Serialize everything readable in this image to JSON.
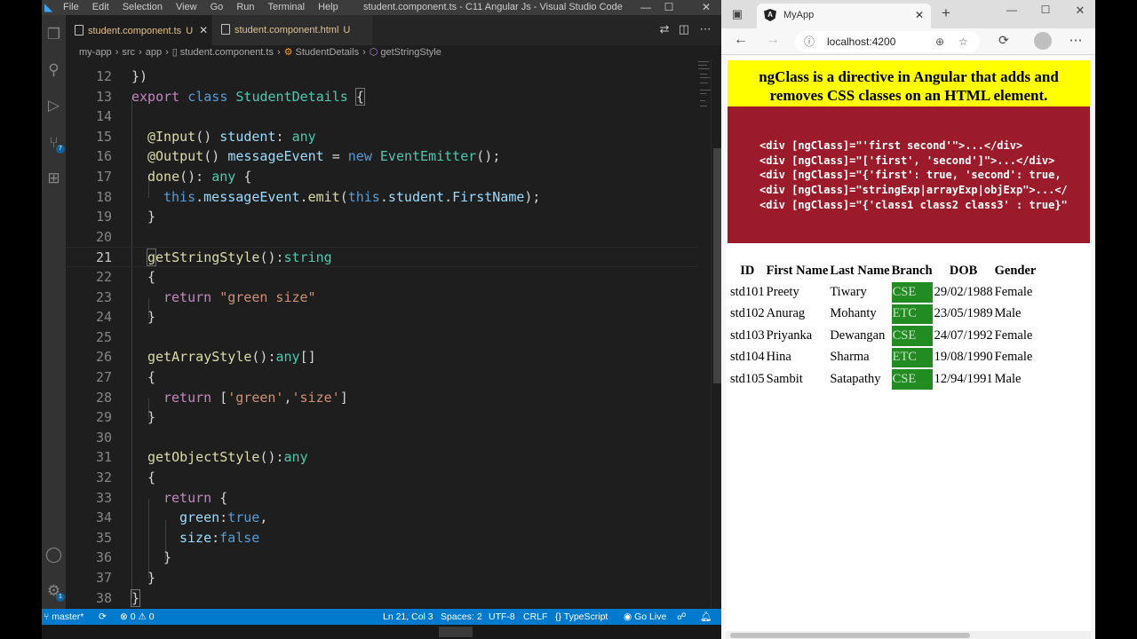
{
  "vscode": {
    "menu": [
      "File",
      "Edit",
      "Selection",
      "View",
      "Go",
      "Run",
      "Terminal",
      "Help"
    ],
    "window_title": "student.component.ts - C11 Angular Js - Visual Studio Code",
    "tabs": [
      {
        "label": "student.component.ts",
        "status": "U",
        "active": true
      },
      {
        "label": "student.component.html",
        "status": "U",
        "active": false
      }
    ],
    "breadcrumb": [
      "my-app",
      "src",
      "app",
      "student.component.ts",
      "StudentDetails",
      "getStringStyle"
    ],
    "line_numbers": [
      "12",
      "13",
      "14",
      "15",
      "16",
      "17",
      "18",
      "19",
      "20",
      "21",
      "22",
      "23",
      "24",
      "25",
      "26",
      "27",
      "28",
      "29",
      "30",
      "31",
      "32",
      "33",
      "34",
      "35",
      "36",
      "37",
      "38"
    ],
    "current_line": "21",
    "code": {
      "l12": "})",
      "l13": {
        "kw": "export",
        "kw2": "class",
        "name": "StudentDetails",
        "brace": "{"
      },
      "l15": {
        "dec": "@Input",
        "paren": "()",
        "prop": "student",
        "colon": ":",
        "type": "any"
      },
      "l16": {
        "dec": "@Output",
        "paren": "()",
        "prop": "messageEvent",
        "eq": " = ",
        "kw": "new",
        "cls": "EventEmitter",
        "tail": "();"
      },
      "l17": {
        "fn": "done",
        "paren": "(): ",
        "type": "any",
        "brace": " {"
      },
      "l18": {
        "this1": "this",
        "dot1": ".",
        "prop1": "messageEvent",
        "dot2": ".",
        "fn": "emit",
        "p1": "(",
        "this2": "this",
        "dot3": ".",
        "prop2": "student",
        "dot4": ".",
        "prop3": "FirstName",
        "tail": ");"
      },
      "l19": "}",
      "l21": {
        "fn_first": "g",
        "fn_rest": "etStringStyle",
        "paren": "():",
        "type": "string"
      },
      "l22": "{",
      "l23": {
        "kw": "return",
        "str": "\"green size\""
      },
      "l24": "}",
      "l26": {
        "fn": "getArrayStyle",
        "paren": "():",
        "type": "any",
        "arr": "[]"
      },
      "l27": "{",
      "l28": {
        "kw": "return",
        "open": "[",
        "s1": "'green'",
        "comma": ",",
        "s2": "'size'",
        "close": "]"
      },
      "l29": "}",
      "l31": {
        "fn": "getObjectStyle",
        "paren": "():",
        "type": "any"
      },
      "l32": "{",
      "l33": {
        "kw": "return",
        "brace": " {"
      },
      "l34": {
        "key": "green",
        "colon": ":",
        "val": "true",
        "comma": ","
      },
      "l35": {
        "key": "size",
        "colon": ":",
        "val": "false"
      },
      "l36": "}",
      "l37": "}",
      "l38": "}"
    },
    "status": {
      "branch": "master*",
      "problems": "⊗ 0 ⚠ 0",
      "position": "Ln 21, Col 3",
      "spaces": "Spaces: 2",
      "encoding": "UTF-8",
      "eol": "CRLF",
      "language": "TypeScript",
      "golive": "Go Live"
    },
    "source_control_badge": "7",
    "accounts_badge": "1"
  },
  "browser": {
    "tab_title": "MyApp",
    "url": "localhost:4200",
    "heading_line1": "ngClass is a directive in Angular that adds and",
    "heading_line2": "removes CSS classes on an HTML element.",
    "code_lines": [
      "<div [ngClass]=\"'first second'\">...</div>",
      "<div [ngClass]=\"['first', 'second']\">...</div>",
      "<div [ngClass]=\"{'first': true, 'second': true,",
      "<div [ngClass]=\"stringExp|arrayExp|objExp\">...</",
      "<div [ngClass]=\"{'class1 class2 class3' : true}\""
    ],
    "table": {
      "headers": [
        "ID",
        "First Name",
        "Last Name",
        "Branch",
        "DOB",
        "Gender"
      ],
      "rows": [
        [
          "std101",
          "Preety",
          "Tiwary",
          "CSE",
          "29/02/1988",
          "Female"
        ],
        [
          "std102",
          "Anurag",
          "Mohanty",
          "ETC",
          "23/05/1989",
          "Male"
        ],
        [
          "std103",
          "Priyanka",
          "Dewangan",
          "CSE",
          "24/07/1992",
          "Female"
        ],
        [
          "std104",
          "Hina",
          "Sharma",
          "ETC",
          "19/08/1990",
          "Female"
        ],
        [
          "std105",
          "Sambit",
          "Satapathy",
          "CSE",
          "12/94/1991",
          "Male"
        ]
      ]
    },
    "colors": {
      "heading_bg": "#ffff00",
      "code_bg": "#9b1b2a",
      "branch_bg": "#228b22"
    }
  }
}
